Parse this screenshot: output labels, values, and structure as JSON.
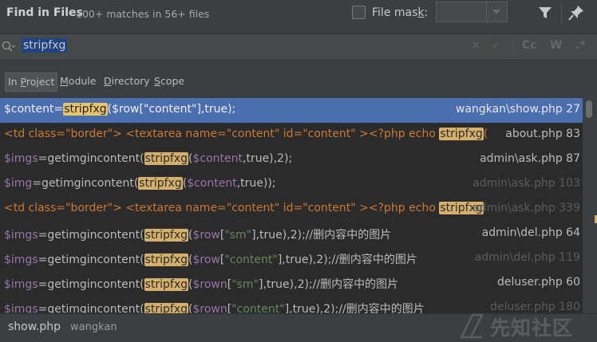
{
  "header": {
    "title": "Find in Files",
    "match_count": "100+ matches in 56+ files",
    "file_mask_label_main": "File mas",
    "file_mask_label_key": "k",
    "file_mask_label_colon": ":",
    "file_mask_value": ""
  },
  "search": {
    "query": "stripfxg",
    "option_clear": "×",
    "option_replace": "⤶",
    "option_case": "Cc",
    "option_words": "W",
    "option_regex": ".*"
  },
  "scope": {
    "tabs": [
      {
        "pre": "In ",
        "key": "P",
        "post": "roject"
      },
      {
        "pre": "",
        "key": "M",
        "post": "odule"
      },
      {
        "pre": "",
        "key": "D",
        "post": "irectory"
      },
      {
        "pre": "",
        "key": "S",
        "post": "cope"
      }
    ]
  },
  "results": [
    {
      "file": "wangkan\\show.php 27",
      "segments": [
        [
          "$content=",
          ""
        ],
        [
          "stripfxg",
          "hl"
        ],
        [
          "($row[\"content\"],true);",
          ""
        ]
      ]
    },
    {
      "file": "about.php 83",
      "segments": [
        [
          "<td class=\"border\"> <textarea name=\"content\" id=\"content\" ><?php echo ",
          "kw"
        ],
        [
          "stripfxg",
          "hl"
        ],
        [
          "(",
          "kw"
        ]
      ]
    },
    {
      "file": "admin\\ask.php 87",
      "segments": [
        [
          "$imgs",
          "var"
        ],
        [
          "=getimgincontent(",
          ""
        ],
        [
          "stripfxg",
          "hl"
        ],
        [
          "(",
          ""
        ],
        [
          "$content",
          "var"
        ],
        [
          ",true),2);",
          ""
        ]
      ]
    },
    {
      "file": "admin\\ask.php 103",
      "dim": true,
      "segments": [
        [
          "$img",
          "var"
        ],
        [
          "=getimgincontent(",
          ""
        ],
        [
          "stripfxg",
          "hl"
        ],
        [
          "(",
          ""
        ],
        [
          "$content",
          "var"
        ],
        [
          ",true));",
          ""
        ]
      ]
    },
    {
      "file": "admin\\ask.php 339",
      "dim": true,
      "segments": [
        [
          "<td class=\"border\"> <textarea name=\"content\" id=\"content\" ><?php echo ",
          "kw"
        ],
        [
          "stripfxg",
          "hl"
        ]
      ]
    },
    {
      "file": "admin\\del.php 64",
      "segments": [
        [
          "$imgs",
          "var"
        ],
        [
          "=getimgincontent(",
          ""
        ],
        [
          "stripfxg",
          "hl"
        ],
        [
          "(",
          ""
        ],
        [
          "$row",
          "var"
        ],
        [
          "[",
          ""
        ],
        [
          "\"sm\"",
          "str"
        ],
        [
          "],true),2);//删内容中的图片",
          ""
        ]
      ]
    },
    {
      "file": "admin\\del.php 119",
      "dim": true,
      "segments": [
        [
          "$imgs",
          "var"
        ],
        [
          "=getimgincontent(",
          ""
        ],
        [
          "stripfxg",
          "hl"
        ],
        [
          "(",
          ""
        ],
        [
          "$row",
          "var"
        ],
        [
          "[",
          ""
        ],
        [
          "\"content\"",
          "str"
        ],
        [
          "],true),2);//删内容中的图片",
          ""
        ]
      ]
    },
    {
      "file": "deluser.php 60",
      "segments": [
        [
          "$imgs",
          "var"
        ],
        [
          "=getimgincontent(",
          ""
        ],
        [
          "stripfxg",
          "hl"
        ],
        [
          "(",
          ""
        ],
        [
          "$rown",
          "var"
        ],
        [
          "[",
          ""
        ],
        [
          "\"sm\"",
          "str"
        ],
        [
          "],true),2);//删内容中的图片",
          ""
        ]
      ]
    },
    {
      "file": "deluser.php 180",
      "dim": true,
      "segments": [
        [
          "$imgs",
          "var"
        ],
        [
          "=getimgincontent(",
          ""
        ],
        [
          "stripfxg",
          "hl"
        ],
        [
          "(",
          ""
        ],
        [
          "$rown",
          "var"
        ],
        [
          "[",
          ""
        ],
        [
          "\"content\"",
          "str"
        ],
        [
          "],true),2);//删内容中的图片",
          ""
        ]
      ]
    }
  ],
  "footer": {
    "file_name": "show.php",
    "directory": "wangkan"
  },
  "watermark": {
    "text": "先知社区"
  },
  "colors": {
    "selection": "#4b6eaf",
    "match_highlight": "#d4b06a",
    "keyword": "#cc7832",
    "variable": "#9876aa",
    "string": "#6a8759"
  }
}
